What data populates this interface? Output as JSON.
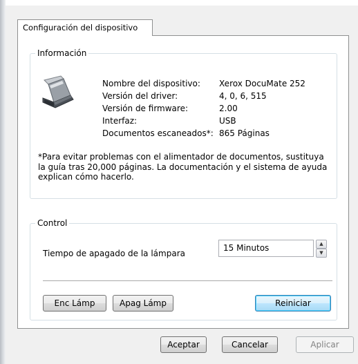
{
  "tab": {
    "label": "Configuración del dispositivo"
  },
  "info": {
    "legend": "Información",
    "rows": [
      {
        "label": "Nombre del dispositivo:",
        "value": "Xerox DocuMate 252"
      },
      {
        "label": "Versión del driver:",
        "value": "4, 0, 6, 515"
      },
      {
        "label": "Versión de firmware:",
        "value": "2.00"
      },
      {
        "label": "Interfaz:",
        "value": "USB"
      },
      {
        "label": "Documentos escaneados*:",
        "value": "865 Páginas"
      }
    ],
    "note": "*Para evitar problemas con el alimentador de documentos, sustituya la guía tras 20,000 páginas. La documentación y el sistema de ayuda explican cómo hacerlo."
  },
  "control": {
    "legend": "Control",
    "lamp_label": "Tiempo de apagado de la lámpara",
    "lamp_value": "15 Minutos",
    "lamp_on": "Enc Lámp",
    "lamp_off": "Apag Lámp",
    "reset": "Reiniciar"
  },
  "footer": {
    "ok": "Aceptar",
    "cancel": "Cancelar",
    "apply": "Aplicar"
  },
  "icons": {
    "scanner": "scanner-icon",
    "spin_up": "spin-up-icon",
    "spin_down": "spin-down-icon"
  }
}
